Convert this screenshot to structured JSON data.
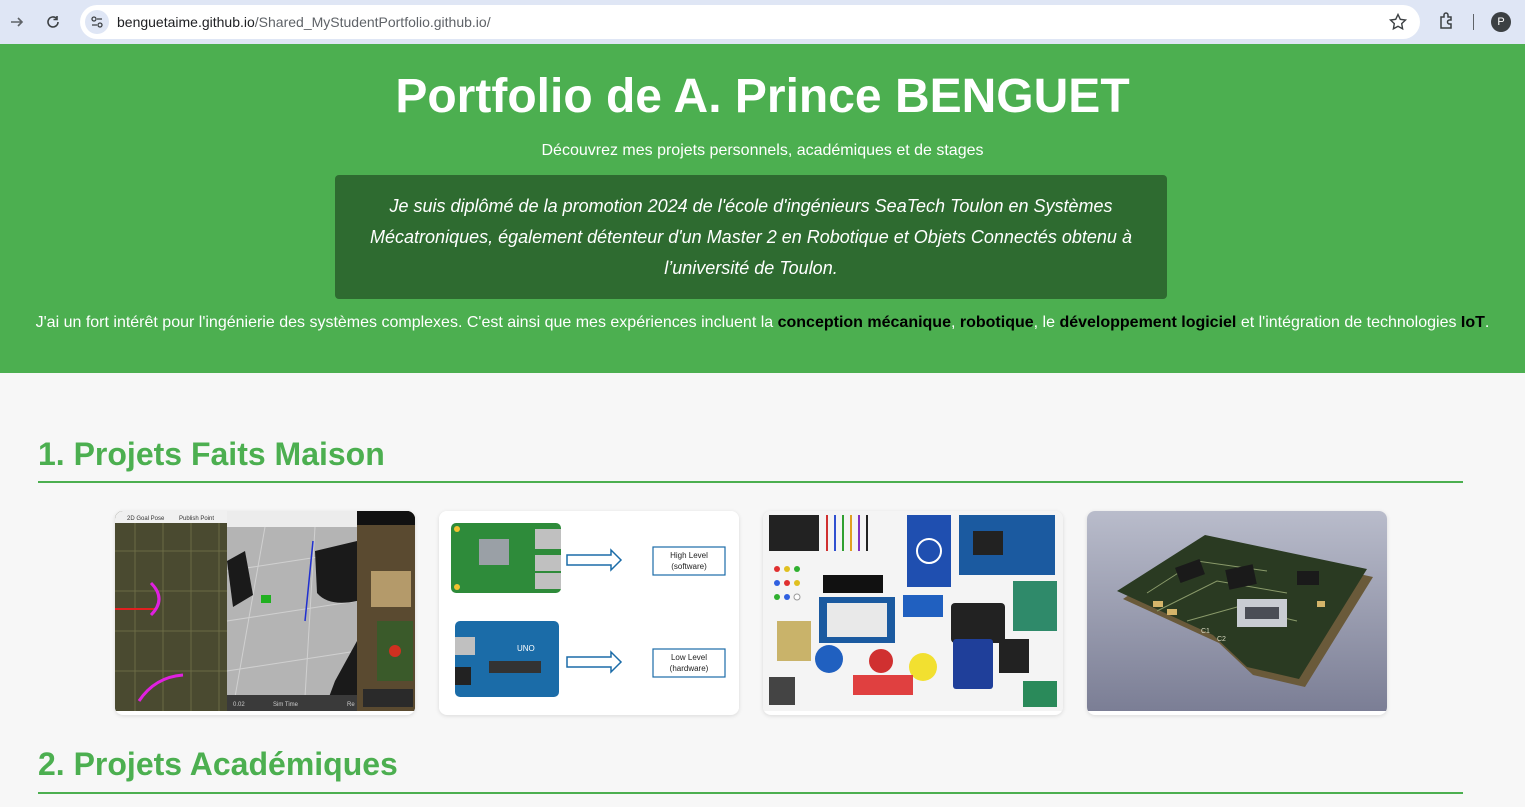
{
  "browser": {
    "url_host": "benguetaime.github.io",
    "url_path": "/Shared_MyStudentPortfolio.github.io/",
    "profile_initial": "P"
  },
  "header": {
    "title": "Portfolio de A. Prince BENGUET",
    "subtitle": "Découvrez mes projets personnels, académiques et de stages",
    "intro": "Je suis diplômé de la promotion 2024 de l'école d'ingénieurs SeaTech Toulon en Systèmes Mécatroniques, également détenteur d'un Master 2 en Robotique et Objets Connectés obtenu à l’université de Toulon.",
    "interest": {
      "text1": "J'ai un fort intérêt pour l'ingénierie des systèmes complexes. C'est ainsi que mes expériences incluent la ",
      "kw1": "conception mécanique",
      "text2": ", ",
      "kw2": "robotique",
      "text3": ", le ",
      "kw3": "développement logiciel",
      "text4": " et l'intégration de technologies ",
      "kw4": "IoT",
      "text5": "."
    }
  },
  "sections": [
    {
      "title": "1. Projets Faits Maison"
    },
    {
      "title": "2. Projets Académiques"
    }
  ],
  "cards": [
    {
      "image": "robot-simulation-screenshot",
      "ui_labels": [
        "2D Goal Pose",
        "Publish Point",
        "Sim Time",
        "Re"
      ],
      "sim_readout": "0.02"
    },
    {
      "image": "raspberry-arduino-diagram",
      "boxes": [
        {
          "line1": "High Level",
          "line2": "(software)"
        },
        {
          "line1": "Low Level",
          "line2": "(hardware)"
        }
      ]
    },
    {
      "image": "electronics-kit-photo"
    },
    {
      "image": "pcb-3d-render",
      "silkscreen": [
        "C1",
        "C2"
      ]
    }
  ],
  "colors": {
    "primary": "#4caf50",
    "intro_box": "#2e6b30",
    "page_bg": "#f7f7f7",
    "chrome_bg": "#dfe6f5"
  }
}
